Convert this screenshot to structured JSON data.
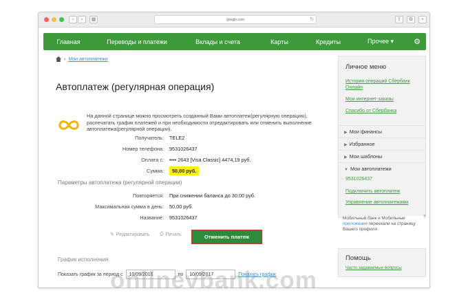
{
  "browser": {
    "url": "google.com",
    "reload_glyph": "↻"
  },
  "topnav": {
    "items": [
      "Главная",
      "Переводы и платежи",
      "Вклады и счета",
      "Карты",
      "Кредиты",
      "Прочее ▾"
    ],
    "gear_glyph": "⚙"
  },
  "breadcrumb": {
    "link": "Мои автоплатежи"
  },
  "page": {
    "title": "Автоплатеж (регулярная операция)",
    "intro": "На данной странице можно просмотреть созданный Вами автоплатеж(регулярную операцию), распечатать график платежей и при необходимости отредактировать или отменить выполнение автоплатежа(регулярной операции)."
  },
  "details": [
    {
      "label": "Получатель:",
      "value": "TELE2"
    },
    {
      "label": "Номер телефона:",
      "value": "9531026437"
    },
    {
      "label": "Оплата с:",
      "value": "•••• 2643  [Visa Classic]  4474,19 руб."
    },
    {
      "label": "Сумма:",
      "value": "50,00 руб."
    }
  ],
  "params_section": {
    "title": "Параметры автоплатежа (регулярной операции)",
    "rows": [
      {
        "label": "Повторяется:",
        "value": "При снижении баланса до   30,00 руб."
      },
      {
        "label": "Максимальная сумма в день:",
        "value": "50,00 руб."
      },
      {
        "label": "Название:",
        "value": "9531026437"
      }
    ]
  },
  "actions": {
    "edit": "Редактировать",
    "print": "Печать",
    "cancel": "Отменить платеж"
  },
  "schedule": {
    "title": "График исполнения",
    "label": "Показать график за период с",
    "to_label": "по",
    "date_from": "10/09/2016",
    "date_to": "10/09/2017",
    "show_link": "Показать график"
  },
  "sidebar": {
    "title": "Личное меню",
    "links": [
      "История операций Сбербанк Онлайн",
      "Мои интернет-заказы",
      "Спасибо от Сбербанка"
    ],
    "sections": [
      "Мои финансы",
      "Избранное",
      "Мои шаблоны",
      "Мои автоплатежи"
    ],
    "autopay_items": [
      "9531026437",
      "Подключить автоплатеж",
      "Управление автоплатежами"
    ]
  },
  "promo": {
    "text_before": "Мобильный банк и Мобильные ",
    "link": "приложения",
    "text_after": " переехали на страницу Вашего профиля",
    "close_glyph": "×"
  },
  "help": {
    "title": "Помощь",
    "link": "Часто задаваемые вопросы"
  },
  "watermark": "onlinevbank.com",
  "colors": {
    "nav_green": "#3c9a3b",
    "button_green": "#2e8b3a",
    "highlight": "#fff200",
    "button_border": "#c0392b"
  }
}
